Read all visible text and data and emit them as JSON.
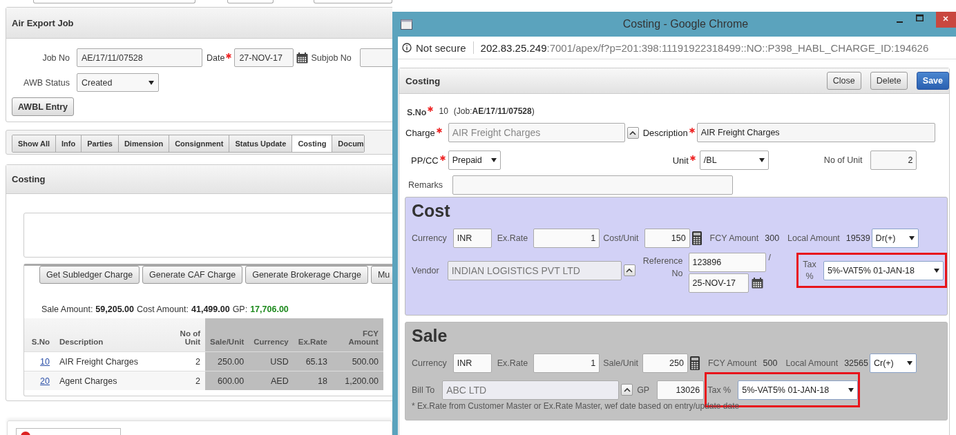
{
  "background": {
    "job_panel": {
      "title": "Air Export Job",
      "job_no": {
        "label": "Job No",
        "value": "AE/17/11/07528"
      },
      "date": {
        "label": "Date",
        "required": true,
        "value": "27-NOV-17"
      },
      "subjob_no": {
        "label": "Subjob No"
      },
      "awb_status": {
        "label": "AWB Status",
        "value": "Created"
      },
      "button": "AWBL Entry"
    },
    "tabs": [
      {
        "label": "Show All",
        "selected": false
      },
      {
        "label": "Info",
        "selected": false
      },
      {
        "label": "Parties",
        "selected": false
      },
      {
        "label": "Dimension",
        "selected": false
      },
      {
        "label": "Consignment",
        "selected": false
      },
      {
        "label": "Status Update",
        "selected": false
      },
      {
        "label": "Costing",
        "selected": true
      },
      {
        "label": "Docum",
        "selected": false
      }
    ],
    "costing_panel": {
      "title": "Costing",
      "buttons": [
        "Get Subledger Charge",
        "Generate CAF Charge",
        "Generate Brokerage Charge",
        "Mu"
      ],
      "summary": [
        {
          "label": "Sale Amount:",
          "value": "59,205.00",
          "color": "#222222"
        },
        {
          "label": "Cost Amount:",
          "value": "41,499.00",
          "color": "#222222"
        },
        {
          "label": "GP:",
          "value": "17,706.00",
          "color": "#1e8a1e"
        }
      ],
      "table": {
        "columns": [
          {
            "label": "S.No",
            "shaded": false
          },
          {
            "label": "Description",
            "shaded": false
          },
          {
            "label": "No of Unit",
            "shaded": false
          },
          {
            "label": "Sale/Unit",
            "shaded": true
          },
          {
            "label": "Currency",
            "shaded": true
          },
          {
            "label": "Ex.Rate",
            "shaded": true
          },
          {
            "label": "FCY Amount",
            "shaded": true
          }
        ],
        "rows": [
          [
            "10",
            "AIR Freight Charges",
            "2",
            "250.00",
            "USD",
            "65.13",
            "500.00"
          ],
          [
            "20",
            "Agent Charges",
            "2",
            "600.00",
            "AED",
            "18",
            "1,200.00"
          ]
        ]
      }
    }
  },
  "popup": {
    "title": "Costing - Google Chrome",
    "security": "Not secure",
    "url_host": "202.83.25.249",
    "url_path": ":7001/apex/f?p=201:398:11191922318499::NO::P398_HABL_CHARGE_ID:194626",
    "panel_title": "Costing",
    "buttons": [
      {
        "label": "Close",
        "primary": false
      },
      {
        "label": "Delete",
        "primary": false
      },
      {
        "label": "Save",
        "primary": true
      }
    ],
    "sno": {
      "label": "S.No",
      "required": true,
      "value": "10",
      "job": "(Job:**AE**/**17**/**11**/**07528**)"
    },
    "charge": {
      "label": "Charge",
      "required": true,
      "value": "AIR Freight Charges"
    },
    "description": {
      "label": "Description",
      "required": true,
      "value": "AIR Freight Charges"
    },
    "pp_cc": {
      "label": "PP/CC",
      "required": true,
      "value": "Prepaid"
    },
    "unit": {
      "label": "Unit",
      "required": true,
      "value": "/BL"
    },
    "no_of_unit": {
      "label": "No of Unit",
      "value": "2"
    },
    "remarks": {
      "label": "Remarks"
    },
    "cost": {
      "kind": "cost",
      "title": "Cost",
      "currency": {
        "label": "Currency",
        "value": "INR"
      },
      "ex_rate": {
        "label": "Ex.Rate",
        "value": "1"
      },
      "unit_price": {
        "label": "Cost/Unit",
        "value": "150"
      },
      "fcy_amount": {
        "label": "FCY Amount",
        "value": "300"
      },
      "local_amount": {
        "label": "Local Amount",
        "value": "19539"
      },
      "direction": {
        "value": "Dr(+)"
      },
      "party": {
        "label": "Vendor",
        "value": "INDIAN LOGISTICS PVT LTD"
      },
      "reference": {
        "label": "Reference No",
        "value": "123896",
        "separator": "/",
        "date": "25-NOV-17"
      },
      "tax": {
        "label": "Tax %",
        "value": "5%-VAT5% 01-JAN-18",
        "highlighted": true
      }
    },
    "sale": {
      "kind": "sale",
      "title": "Sale",
      "currency": {
        "label": "Currency",
        "value": "INR"
      },
      "ex_rate": {
        "label": "Ex.Rate",
        "value": "1"
      },
      "unit_price": {
        "label": "Sale/Unit",
        "value": "250"
      },
      "fcy_amount": {
        "label": "FCY Amount",
        "value": "500"
      },
      "local_amount": {
        "label": "Local Amount",
        "value": "32565"
      },
      "direction": {
        "value": "Cr(+)"
      },
      "party": {
        "label": "Bill To",
        "value": "ABC LTD"
      },
      "gp": {
        "label": "GP",
        "value": "13026"
      },
      "tax": {
        "label": "Tax %",
        "value": "5%-VAT5% 01-JAN-18",
        "highlighted": true
      },
      "note": "* Ex.Rate from Customer Master or Ex.Rate Master, wef date based on entry/update date"
    }
  }
}
